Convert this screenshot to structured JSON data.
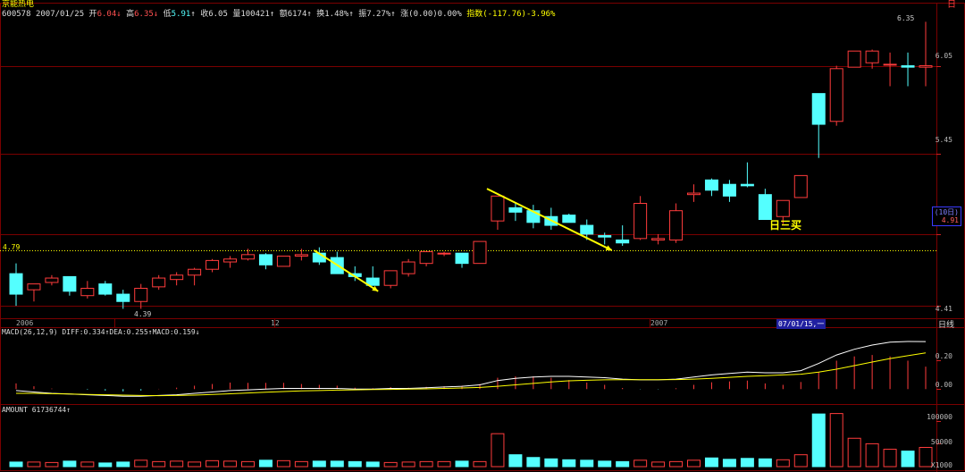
{
  "header": {
    "stock_name": "京能热电",
    "code": "600578",
    "date": "2007/01/25",
    "open_label": "开",
    "open": "6.04",
    "high_label": "高",
    "high": "6.35",
    "low_label": "低",
    "low": "5.91",
    "close_label": "收",
    "close": "6.05",
    "volume_label": "量",
    "volume": "100421",
    "amount_label": "额",
    "amount": "6174",
    "turnover_label": "换",
    "turnover": "1.48%",
    "amplitude_label": "振",
    "amplitude": "7.27%",
    "change_label": "涨",
    "change": "(0.00)0.00%",
    "index_label": "指数",
    "index": "(-117.76)-3.96%"
  },
  "corner_mark": "日",
  "period_label": "日线",
  "price_axis": {
    "ticks": [
      "6.05",
      "5.45",
      "4.90",
      "4.41"
    ]
  },
  "price_box": {
    "top": "(10日)",
    "value": "4.91"
  },
  "time_axis": {
    "labels": [
      "2006",
      "12",
      "2007"
    ],
    "cursor_date": "07/01/15,一"
  },
  "ref_line_label": "4.79",
  "annotation": "日三买",
  "low_label": "4.39",
  "high_label": "6.35",
  "macd_label": "MACD(26,12,9) DIFF:0.334↑DEA:0.255↑MACD:0.159↓",
  "macd_axis": [
    "0.20",
    "0.00"
  ],
  "amount_label": "AMOUNT 61736744↑",
  "amount_axis": [
    "100000",
    "50000",
    "X1000"
  ],
  "colors": {
    "up": "#ff3c3c",
    "down": "#54ffff",
    "diff": "#ffffff",
    "dea": "#ffff00",
    "arrow": "#ffff00",
    "grid": "#7a0000"
  },
  "chart_data": {
    "type": "candlestick",
    "title": "京能热电",
    "ylim": [
      4.35,
      6.45
    ],
    "ohlc": [
      [
        4.63,
        4.7,
        4.41,
        4.49
      ],
      [
        4.52,
        4.56,
        4.44,
        4.56
      ],
      [
        4.57,
        4.62,
        4.55,
        4.6
      ],
      [
        4.61,
        4.61,
        4.48,
        4.51
      ],
      [
        4.48,
        4.58,
        4.46,
        4.53
      ],
      [
        4.56,
        4.58,
        4.48,
        4.49
      ],
      [
        4.49,
        4.52,
        4.39,
        4.44
      ],
      [
        4.44,
        4.56,
        4.39,
        4.53
      ],
      [
        4.54,
        4.62,
        4.52,
        4.6
      ],
      [
        4.59,
        4.64,
        4.55,
        4.62
      ],
      [
        4.62,
        4.67,
        4.55,
        4.66
      ],
      [
        4.66,
        4.73,
        4.64,
        4.72
      ],
      [
        4.71,
        4.75,
        4.67,
        4.73
      ],
      [
        4.73,
        4.8,
        4.72,
        4.76
      ],
      [
        4.76,
        4.77,
        4.66,
        4.69
      ],
      [
        4.68,
        4.75,
        4.68,
        4.75
      ],
      [
        4.75,
        4.8,
        4.72,
        4.76
      ],
      [
        4.77,
        4.81,
        4.69,
        4.71
      ],
      [
        4.74,
        4.78,
        4.63,
        4.63
      ],
      [
        4.63,
        4.68,
        4.58,
        4.61
      ],
      [
        4.6,
        4.68,
        4.55,
        4.55
      ],
      [
        4.55,
        4.65,
        4.53,
        4.65
      ],
      [
        4.63,
        4.73,
        4.61,
        4.71
      ],
      [
        4.7,
        4.78,
        4.68,
        4.78
      ],
      [
        4.77,
        4.78,
        4.75,
        4.77
      ],
      [
        4.77,
        4.77,
        4.67,
        4.7
      ],
      [
        4.7,
        4.85,
        4.7,
        4.85
      ],
      [
        4.99,
        5.16,
        4.93,
        5.16
      ],
      [
        5.08,
        5.11,
        4.99,
        5.05
      ],
      [
        5.06,
        5.1,
        4.94,
        4.98
      ],
      [
        5.02,
        5.08,
        4.93,
        4.96
      ],
      [
        5.03,
        5.04,
        4.98,
        4.98
      ],
      [
        4.96,
        5.0,
        4.86,
        4.9
      ],
      [
        4.89,
        4.91,
        4.83,
        4.88
      ],
      [
        4.86,
        4.96,
        4.82,
        4.84
      ],
      [
        4.87,
        5.16,
        4.86,
        5.11
      ],
      [
        4.86,
        4.9,
        4.83,
        4.87
      ],
      [
        4.86,
        5.11,
        4.84,
        5.06
      ],
      [
        5.17,
        5.24,
        5.12,
        5.18
      ],
      [
        5.27,
        5.28,
        5.16,
        5.2
      ],
      [
        5.24,
        5.27,
        5.12,
        5.16
      ],
      [
        5.24,
        5.39,
        5.22,
        5.23
      ],
      [
        5.17,
        5.21,
        5.0,
        5.0
      ],
      [
        5.02,
        5.12,
        4.97,
        5.13
      ],
      [
        5.15,
        5.3,
        5.15,
        5.3
      ],
      [
        5.86,
        5.86,
        5.42,
        5.65
      ],
      [
        5.67,
        6.05,
        5.64,
        6.03
      ],
      [
        6.04,
        6.14,
        6.04,
        6.15
      ],
      [
        6.07,
        6.16,
        6.03,
        6.15
      ],
      [
        6.06,
        6.14,
        5.91,
        6.06
      ],
      [
        6.05,
        6.14,
        5.91,
        6.04
      ],
      [
        6.04,
        6.35,
        5.91,
        6.05
      ]
    ],
    "diff": [
      -0.01,
      -0.02,
      -0.03,
      -0.035,
      -0.04,
      -0.045,
      -0.05,
      -0.05,
      -0.045,
      -0.04,
      -0.03,
      -0.02,
      -0.01,
      -0.005,
      0.0,
      0.005,
      0.005,
      0.005,
      0.005,
      0.0,
      0.0,
      0.005,
      0.005,
      0.01,
      0.015,
      0.02,
      0.03,
      0.06,
      0.075,
      0.085,
      0.09,
      0.09,
      0.085,
      0.08,
      0.07,
      0.065,
      0.065,
      0.07,
      0.085,
      0.1,
      0.11,
      0.12,
      0.115,
      0.115,
      0.13,
      0.18,
      0.24,
      0.28,
      0.31,
      0.33,
      0.335,
      0.334
    ],
    "dea": [
      -0.03,
      -0.03,
      -0.032,
      -0.035,
      -0.038,
      -0.04,
      -0.042,
      -0.045,
      -0.046,
      -0.045,
      -0.042,
      -0.038,
      -0.033,
      -0.027,
      -0.022,
      -0.017,
      -0.013,
      -0.01,
      -0.007,
      -0.005,
      -0.003,
      -0.002,
      0.0,
      0.002,
      0.005,
      0.008,
      0.012,
      0.02,
      0.03,
      0.04,
      0.05,
      0.058,
      0.062,
      0.065,
      0.066,
      0.066,
      0.066,
      0.067,
      0.07,
      0.076,
      0.083,
      0.09,
      0.095,
      0.1,
      0.105,
      0.12,
      0.14,
      0.165,
      0.19,
      0.215,
      0.235,
      0.255
    ],
    "macd_ylim": [
      -0.08,
      0.36
    ],
    "amount": [
      10,
      10,
      9,
      12,
      10,
      8,
      10,
      14,
      11,
      12,
      10,
      13,
      12,
      11,
      14,
      13,
      11,
      12,
      12,
      11,
      10,
      9,
      10,
      11,
      11,
      12,
      11,
      72,
      26,
      20,
      17,
      15,
      14,
      12,
      11,
      14,
      10,
      11,
      14,
      19,
      16,
      18,
      17,
      15,
      26,
      115,
      116,
      62,
      50,
      38,
      34,
      42
    ],
    "amount_ylim": [
      0,
      125
    ]
  }
}
